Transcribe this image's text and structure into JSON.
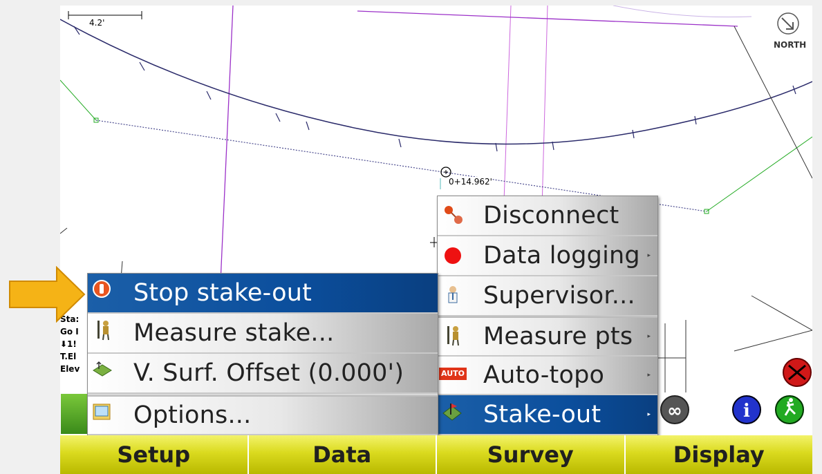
{
  "map": {
    "scale_label": "4.2'",
    "station_label": "0+14.962'",
    "north_label": "NORTH",
    "side_texts": [
      "Sta:",
      "Go I",
      "⬇1!",
      "T.El",
      "Elev"
    ]
  },
  "stakeout_menu": {
    "items": [
      {
        "label": "Stop stake-out",
        "icon": "stop-stakeout-icon",
        "selected": true
      },
      {
        "label": "Measure stake...",
        "icon": "surveyor-pole-icon",
        "selected": false
      },
      {
        "label": "V. Surf. Offset (0.000')",
        "icon": "surface-offset-icon",
        "selected": false
      },
      {
        "label": "Options...",
        "icon": "options-icon",
        "selected": false
      }
    ]
  },
  "survey_menu": {
    "items": [
      {
        "label": "Disconnect",
        "icon": "disconnect-icon",
        "has_submenu": false
      },
      {
        "label": "Data logging",
        "icon": "record-icon",
        "has_submenu": true
      },
      {
        "label": "Supervisor...",
        "icon": "supervisor-icon",
        "has_submenu": false
      },
      {
        "label": "Measure pts",
        "icon": "surveyor-pole-icon",
        "has_submenu": true
      },
      {
        "label": "Auto-topo",
        "icon": "auto-icon",
        "has_submenu": true,
        "badge": "AUTO"
      },
      {
        "label": "Stake-out",
        "icon": "stakeout-icon",
        "has_submenu": true,
        "selected": true
      }
    ]
  },
  "bottom_tabs": [
    "Setup",
    "Data",
    "Survey",
    "Display"
  ],
  "colors": {
    "menu_selected": "#0b4e9c",
    "tab_yellow": "#dada1e",
    "arrow": "#f5b316",
    "alignment_line": "#9b30c8",
    "curve": "#2a2a6a"
  }
}
